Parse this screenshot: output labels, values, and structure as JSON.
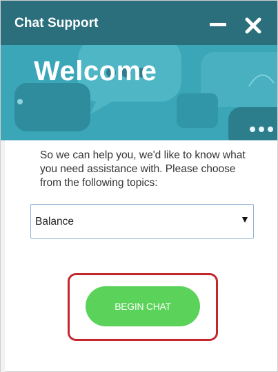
{
  "window": {
    "title": "Chat Support"
  },
  "banner": {
    "heading": "Welcome"
  },
  "intro": {
    "text": "So we can help you, we'd like to know what you need assistance with. Please choose from the following topics:"
  },
  "topic_select": {
    "selected": "Balance"
  },
  "actions": {
    "begin_chat_label": "BEGIN CHAT"
  },
  "icons": {
    "minimize": "minimize-icon",
    "close": "close-icon",
    "dropdown": "chevron-down-icon",
    "banner_decor": "speech-bubble-icon"
  },
  "colors": {
    "titlebar": "#2c6f7c",
    "banner": "#3aa6b8",
    "button": "#5bd259",
    "highlight": "#c4262e"
  }
}
